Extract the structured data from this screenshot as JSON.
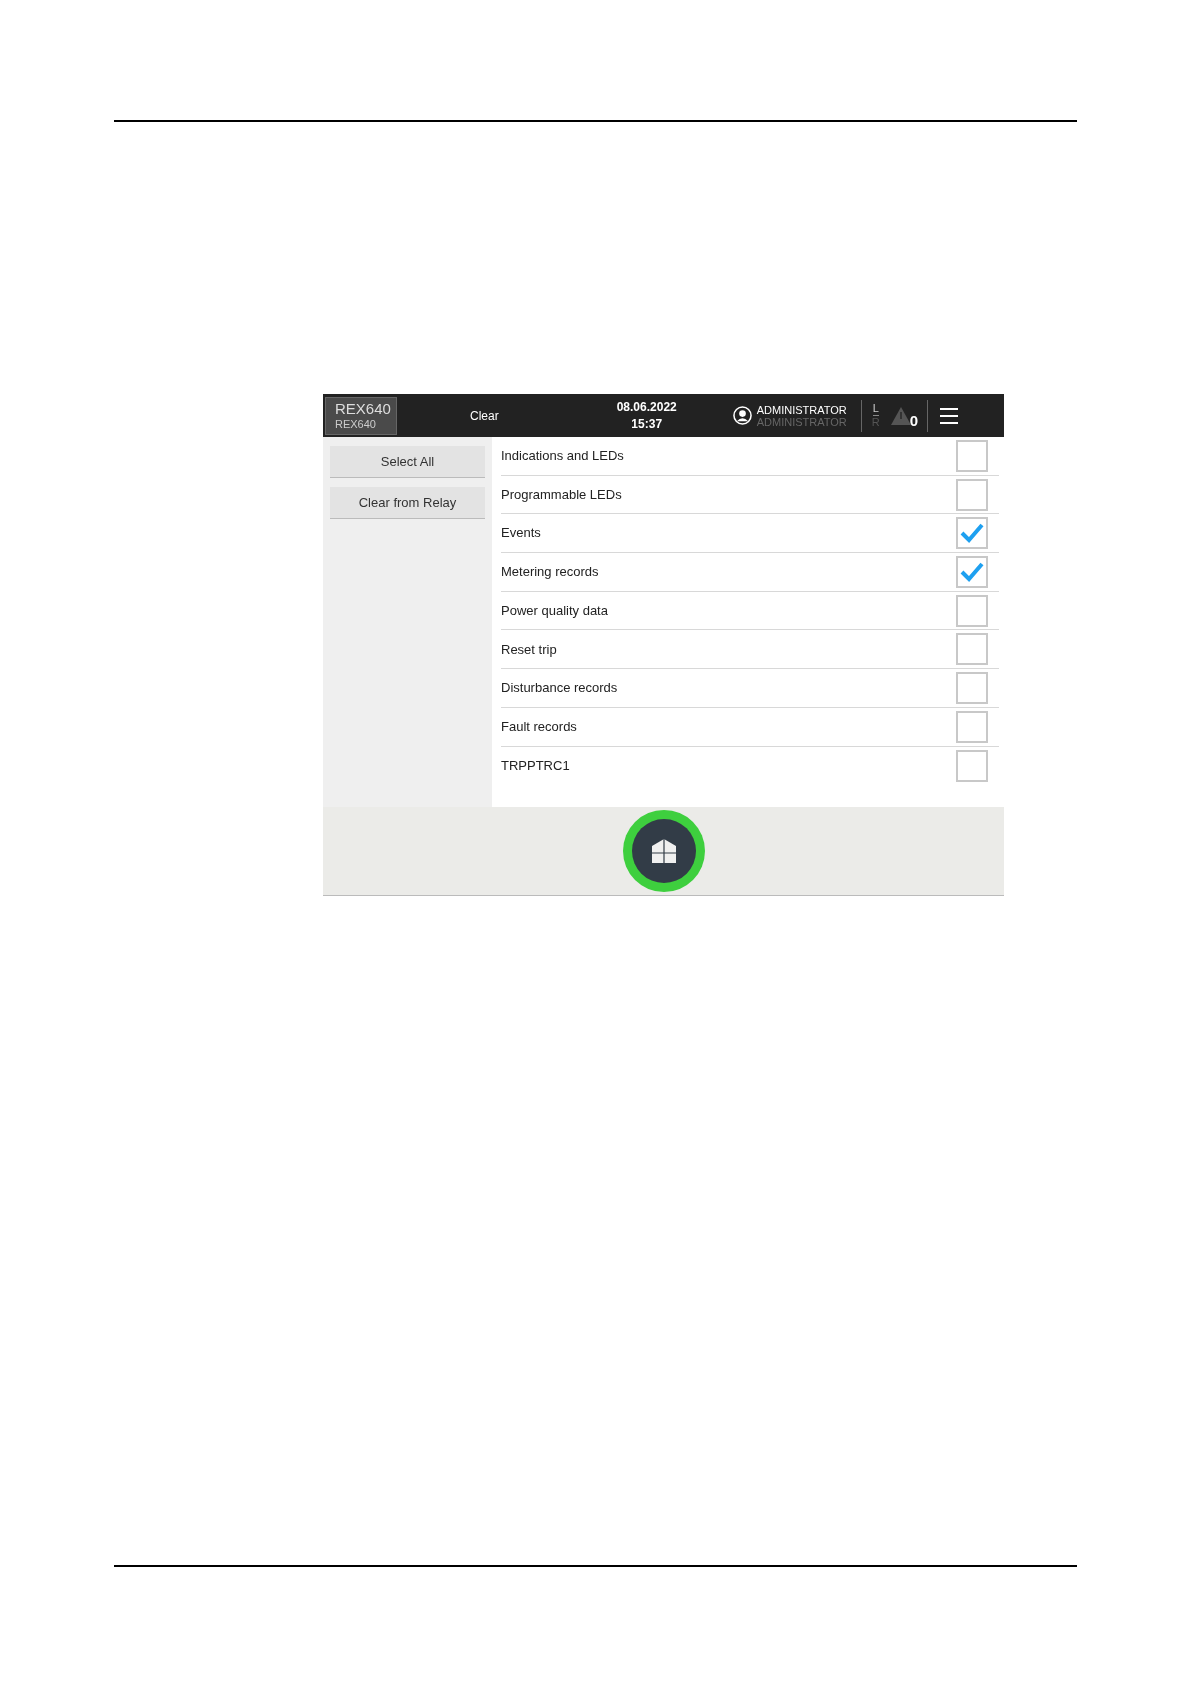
{
  "header": {
    "device_name": "REX640",
    "device_subname": "REX640",
    "title": "Clear",
    "date": "08.06.2022",
    "time": "15:37",
    "user": "ADMINISTRATOR",
    "user_role": "ADMINISTRATOR",
    "local": "L",
    "remote": "R",
    "alarm_count": "0"
  },
  "sidebar": {
    "buttons": [
      "Select All",
      "Clear from Relay"
    ]
  },
  "items": [
    {
      "label": "Indications and LEDs",
      "checked": false
    },
    {
      "label": "Programmable LEDs",
      "checked": false
    },
    {
      "label": "Events",
      "checked": true
    },
    {
      "label": "Metering records",
      "checked": true
    },
    {
      "label": "Power quality data",
      "checked": false
    },
    {
      "label": "Reset trip",
      "checked": false
    },
    {
      "label": "Disturbance records",
      "checked": false
    },
    {
      "label": "Fault records",
      "checked": false
    },
    {
      "label": "TRPPTRC1",
      "checked": false
    }
  ]
}
